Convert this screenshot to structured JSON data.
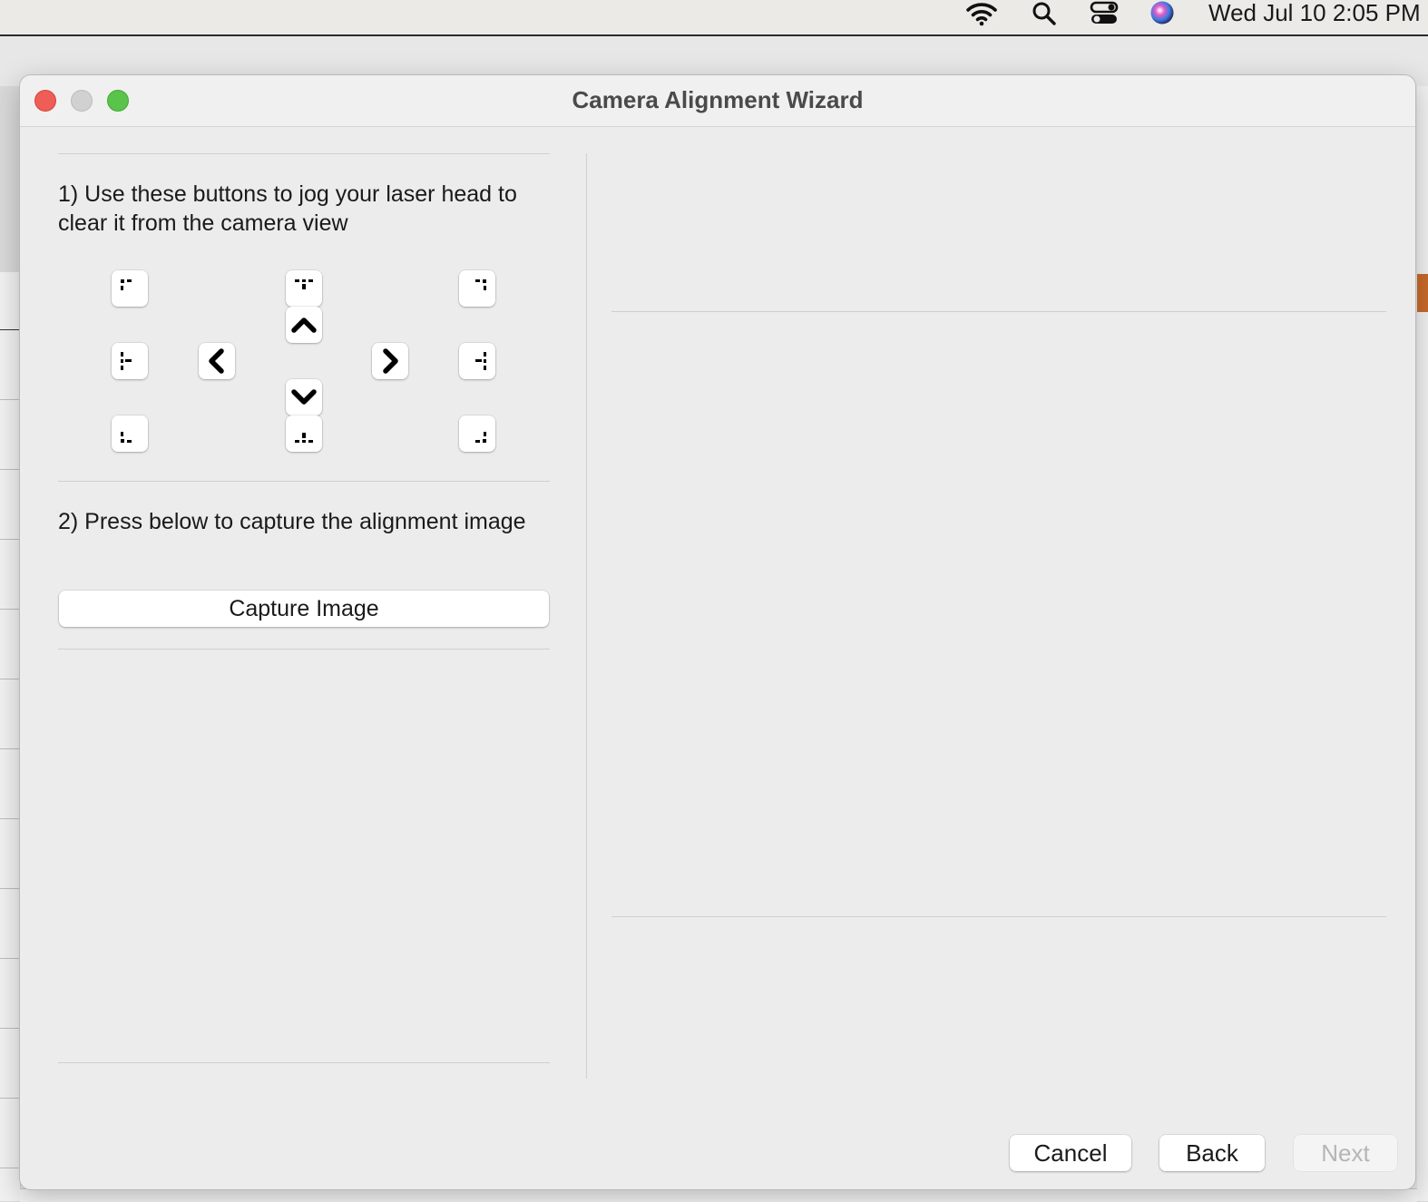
{
  "menubar": {
    "clock": "Wed Jul 10  2:05 PM",
    "icons": [
      "wifi-icon",
      "search-icon",
      "control-center-icon",
      "siri-icon"
    ]
  },
  "window": {
    "title": "Camera Alignment Wizard"
  },
  "step1": {
    "text": "1) Use these buttons to jog your laser head to clear it from the camera view",
    "jog_buttons": [
      "jog-top-left",
      "jog-top-center",
      "jog-top-right",
      "jog-up",
      "jog-left",
      "jog-right",
      "jog-down",
      "jog-middle-left",
      "jog-middle-right",
      "jog-bottom-left",
      "jog-bottom-center",
      "jog-bottom-right"
    ]
  },
  "step2": {
    "text": "2) Press below to capture the alignment image",
    "capture_label": "Capture Image"
  },
  "footer": {
    "cancel_label": "Cancel",
    "back_label": "Back",
    "next_label": "Next",
    "next_enabled": false
  }
}
